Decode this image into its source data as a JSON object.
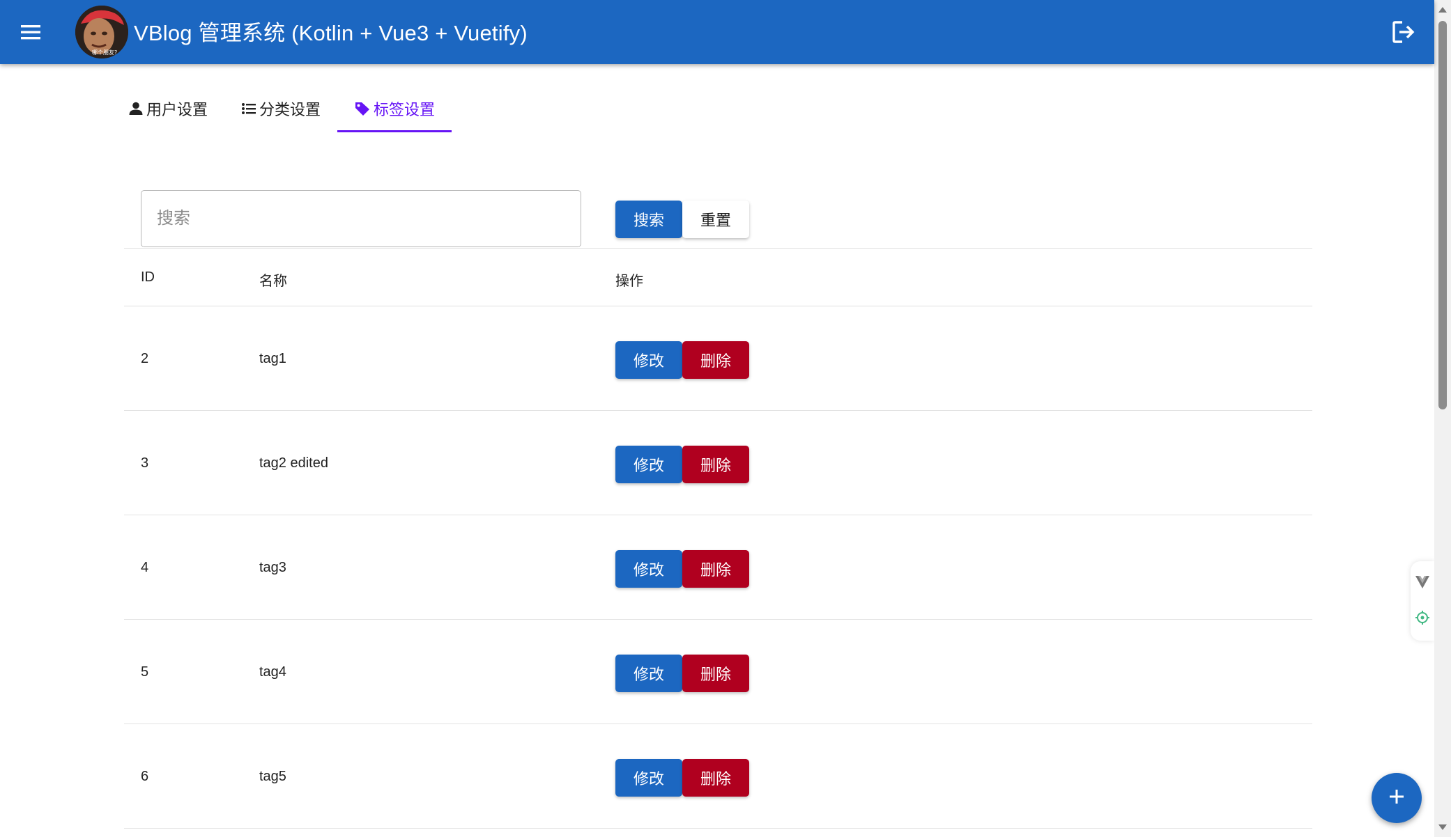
{
  "app": {
    "title": "VBlog 管理系统 (Kotlin + Vue3 + Vuetify)",
    "avatar_caption": "哪个朋友?",
    "primary_color": "#1c67c1",
    "active_tab_color": "#6614f5",
    "danger_color": "#b0001f"
  },
  "tabs": [
    {
      "label": "用户设置",
      "icon": "account-icon"
    },
    {
      "label": "分类设置",
      "icon": "list-icon"
    },
    {
      "label": "标签设置",
      "icon": "tag-icon"
    }
  ],
  "active_tab": "标签设置",
  "search": {
    "placeholder": "搜索",
    "value": "",
    "search_label": "搜索",
    "reset_label": "重置"
  },
  "table": {
    "headers": {
      "id": "ID",
      "name": "名称",
      "actions": "操作"
    },
    "edit_label": "修改",
    "delete_label": "删除",
    "rows": [
      {
        "id": "2",
        "name": "tag1"
      },
      {
        "id": "3",
        "name": "tag2 edited"
      },
      {
        "id": "4",
        "name": "tag3"
      },
      {
        "id": "5",
        "name": "tag4"
      },
      {
        "id": "6",
        "name": "tag5"
      }
    ]
  }
}
